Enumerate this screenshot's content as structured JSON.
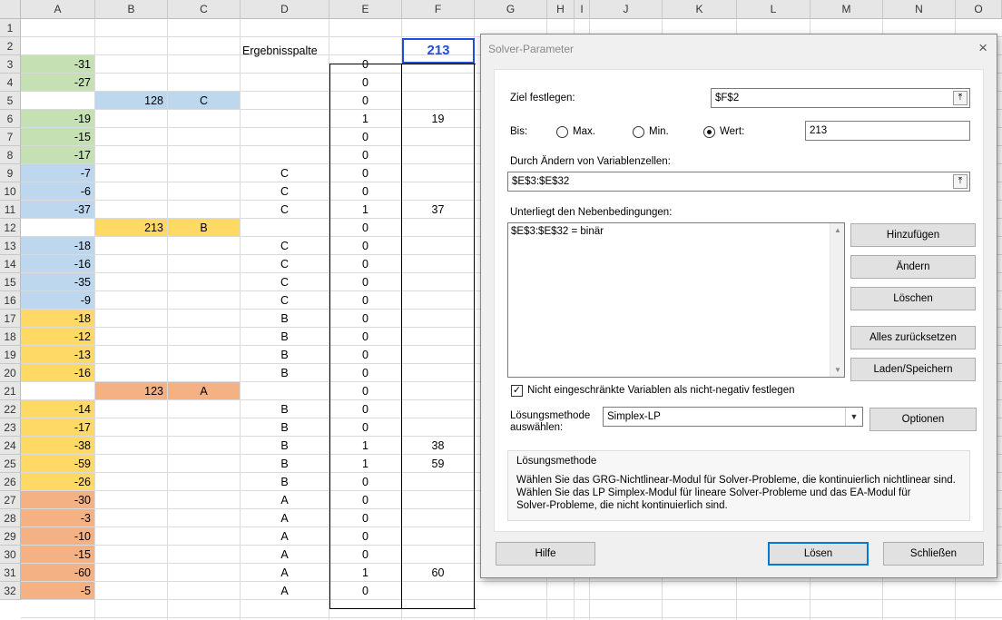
{
  "columns": [
    "A",
    "B",
    "C",
    "D",
    "E",
    "F",
    "G",
    "H",
    "I",
    "J",
    "K",
    "L",
    "M",
    "N",
    "O"
  ],
  "rows": [
    "1",
    "2",
    "3",
    "4",
    "5",
    "6",
    "7",
    "8",
    "9",
    "10",
    "11",
    "12",
    "13",
    "14",
    "15",
    "16",
    "17",
    "18",
    "19",
    "20",
    "21",
    "22",
    "23",
    "24",
    "25",
    "26",
    "27",
    "28",
    "29",
    "30",
    "31",
    "32"
  ],
  "header_cell_d2": "Ergebnisspalte",
  "target_value_f2": "213",
  "col_a": [
    {
      "row": 3,
      "value": "-31",
      "color": "green"
    },
    {
      "row": 4,
      "value": "-27",
      "color": "green"
    },
    {
      "row": 6,
      "value": "-19",
      "color": "green"
    },
    {
      "row": 7,
      "value": "-15",
      "color": "green"
    },
    {
      "row": 8,
      "value": "-17",
      "color": "green"
    },
    {
      "row": 9,
      "value": "-7",
      "color": "blue"
    },
    {
      "row": 10,
      "value": "-6",
      "color": "blue"
    },
    {
      "row": 11,
      "value": "-37",
      "color": "blue"
    },
    {
      "row": 13,
      "value": "-18",
      "color": "blue"
    },
    {
      "row": 14,
      "value": "-16",
      "color": "blue"
    },
    {
      "row": 15,
      "value": "-35",
      "color": "blue"
    },
    {
      "row": 16,
      "value": "-9",
      "color": "blue"
    },
    {
      "row": 17,
      "value": "-18",
      "color": "yellow"
    },
    {
      "row": 18,
      "value": "-12",
      "color": "yellow"
    },
    {
      "row": 19,
      "value": "-13",
      "color": "yellow"
    },
    {
      "row": 20,
      "value": "-16",
      "color": "yellow"
    },
    {
      "row": 22,
      "value": "-14",
      "color": "yellow"
    },
    {
      "row": 23,
      "value": "-17",
      "color": "yellow"
    },
    {
      "row": 24,
      "value": "-38",
      "color": "yellow"
    },
    {
      "row": 25,
      "value": "-59",
      "color": "yellow"
    },
    {
      "row": 26,
      "value": "-26",
      "color": "yellow"
    },
    {
      "row": 27,
      "value": "-30",
      "color": "orange"
    },
    {
      "row": 28,
      "value": "-3",
      "color": "orange"
    },
    {
      "row": 29,
      "value": "-10",
      "color": "orange"
    },
    {
      "row": 30,
      "value": "-15",
      "color": "orange"
    },
    {
      "row": 31,
      "value": "-60",
      "color": "orange"
    },
    {
      "row": 32,
      "value": "-5",
      "color": "orange"
    }
  ],
  "group_rows": [
    {
      "row": 5,
      "value": "128",
      "label": "C",
      "color": "blue"
    },
    {
      "row": 12,
      "value": "213",
      "label": "B",
      "color": "yellow"
    },
    {
      "row": 21,
      "value": "123",
      "label": "A",
      "color": "orange"
    }
  ],
  "col_d": [
    {
      "row": 9,
      "value": "C"
    },
    {
      "row": 10,
      "value": "C"
    },
    {
      "row": 11,
      "value": "C"
    },
    {
      "row": 13,
      "value": "C"
    },
    {
      "row": 14,
      "value": "C"
    },
    {
      "row": 15,
      "value": "C"
    },
    {
      "row": 16,
      "value": "C"
    },
    {
      "row": 17,
      "value": "B"
    },
    {
      "row": 18,
      "value": "B"
    },
    {
      "row": 19,
      "value": "B"
    },
    {
      "row": 20,
      "value": "B"
    },
    {
      "row": 22,
      "value": "B"
    },
    {
      "row": 23,
      "value": "B"
    },
    {
      "row": 24,
      "value": "B"
    },
    {
      "row": 25,
      "value": "B"
    },
    {
      "row": 26,
      "value": "B"
    },
    {
      "row": 27,
      "value": "A"
    },
    {
      "row": 28,
      "value": "A"
    },
    {
      "row": 29,
      "value": "A"
    },
    {
      "row": 30,
      "value": "A"
    },
    {
      "row": 31,
      "value": "A"
    },
    {
      "row": 32,
      "value": "A"
    }
  ],
  "col_e": [
    {
      "row": 3,
      "value": "0"
    },
    {
      "row": 4,
      "value": "0"
    },
    {
      "row": 5,
      "value": "0"
    },
    {
      "row": 6,
      "value": "1"
    },
    {
      "row": 7,
      "value": "0"
    },
    {
      "row": 8,
      "value": "0"
    },
    {
      "row": 9,
      "value": "0"
    },
    {
      "row": 10,
      "value": "0"
    },
    {
      "row": 11,
      "value": "1"
    },
    {
      "row": 12,
      "value": "0"
    },
    {
      "row": 13,
      "value": "0"
    },
    {
      "row": 14,
      "value": "0"
    },
    {
      "row": 15,
      "value": "0"
    },
    {
      "row": 16,
      "value": "0"
    },
    {
      "row": 17,
      "value": "0"
    },
    {
      "row": 18,
      "value": "0"
    },
    {
      "row": 19,
      "value": "0"
    },
    {
      "row": 20,
      "value": "0"
    },
    {
      "row": 21,
      "value": "0"
    },
    {
      "row": 22,
      "value": "0"
    },
    {
      "row": 23,
      "value": "0"
    },
    {
      "row": 24,
      "value": "1"
    },
    {
      "row": 25,
      "value": "1"
    },
    {
      "row": 26,
      "value": "0"
    },
    {
      "row": 27,
      "value": "0"
    },
    {
      "row": 28,
      "value": "0"
    },
    {
      "row": 29,
      "value": "0"
    },
    {
      "row": 30,
      "value": "0"
    },
    {
      "row": 31,
      "value": "1"
    },
    {
      "row": 32,
      "value": "0"
    }
  ],
  "col_f": [
    {
      "row": 6,
      "value": "19"
    },
    {
      "row": 11,
      "value": "37"
    },
    {
      "row": 24,
      "value": "38"
    },
    {
      "row": 25,
      "value": "59"
    },
    {
      "row": 31,
      "value": "60"
    }
  ],
  "colors": {
    "green": "#c5e0b3",
    "blue": "#bdd7ee",
    "yellow": "#ffd966",
    "orange": "#f4b183",
    "selection": "#1f4fd8"
  },
  "dialog": {
    "title": "Solver-Parameter",
    "close_icon": "×",
    "target_label": "Ziel festlegen:",
    "target_value": "$F$2",
    "to_label": "Bis:",
    "opt_max": "Max.",
    "opt_min": "Min.",
    "opt_value": "Wert:",
    "selected_option": "value",
    "value_field": "213",
    "variable_label": "Durch Ändern von Variablenzellen:",
    "variable_value": "$E$3:$E$32",
    "constraints_label": "Unterliegt den Nebenbedingungen:",
    "constraints": [
      "$E$3:$E$32 = binär"
    ],
    "btn_add": "Hinzufügen",
    "btn_change": "Ändern",
    "btn_delete": "Löschen",
    "btn_reset": "Alles zurücksetzen",
    "btn_load": "Laden/Speichern",
    "nonneg_label": "Nicht eingeschränkte Variablen als nicht-negativ festlegen",
    "nonneg_checked": true,
    "method_label_1": "Lösungsmethode",
    "method_label_2": "auswählen:",
    "method_value": "Simplex-LP",
    "btn_options": "Optionen",
    "group_title": "Lösungsmethode",
    "group_text_1": "Wählen Sie das GRG-Nichtlinear-Modul für Solver-Probleme, die kontinuierlich nichtlinear sind.",
    "group_text_2": "Wählen Sie das LP Simplex-Modul für lineare Solver-Probleme und das EA-Modul für",
    "group_text_3": "Solver-Probleme, die nicht kontinuierlich sind.",
    "btn_help": "Hilfe",
    "btn_solve": "Lösen",
    "btn_close": "Schließen"
  }
}
